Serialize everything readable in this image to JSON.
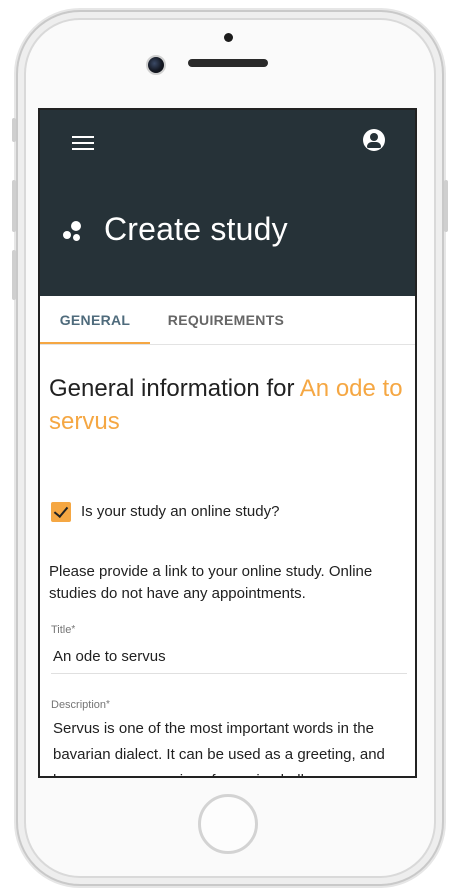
{
  "appbar": {
    "title": "Create study",
    "menu_icon": "menu-icon",
    "account_icon": "account-circle-icon",
    "logo_icon": "dots-logo-icon",
    "background": "#263238"
  },
  "tabs": [
    {
      "label": "GENERAL",
      "active": true
    },
    {
      "label": "REQUIREMENTS",
      "active": false
    }
  ],
  "form": {
    "heading_prefix": "General information for ",
    "heading_accent": "An ode to servus",
    "accent_color": "#f5a743",
    "online_checkbox": {
      "label": "Is your study an online study?",
      "checked": true
    },
    "online_info": "Please provide a link to your online study. Online studies do not have any appointments.",
    "title_field": {
      "label": "Title",
      "required_mark": "*",
      "value": "An ode to servus"
    },
    "description_field": {
      "label": "Description",
      "required_mark": "*",
      "value": "Servus is one of the most important words in the bavarian dialect. It can be used as a greeting, and has so many meanings for saying hello"
    }
  }
}
